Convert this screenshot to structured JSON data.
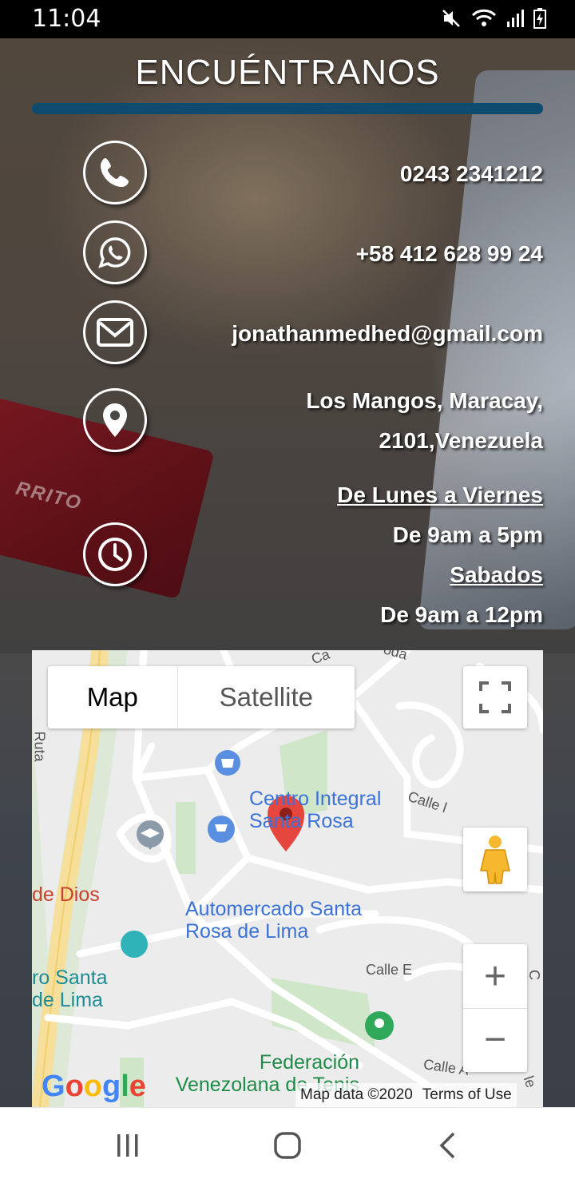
{
  "status_bar": {
    "time": "11:04",
    "icons": [
      "mute-icon",
      "wifi-icon",
      "signal-icon",
      "battery-charging-icon"
    ]
  },
  "header": {
    "title": "ENCUÉNTRANOS",
    "accent_color": "#0e4b6e"
  },
  "contact": {
    "phone": "0243 2341212",
    "whatsapp": "+58 412 628 99 24",
    "email": "jonathanmedhed@gmail.com",
    "address_line1": "Los Mangos, Maracay,",
    "address_line2": "2101,Venezuela",
    "hours": {
      "weekday_label": "De Lunes a Viernes",
      "weekday_hours": "De 9am a 5pm",
      "saturday_label": "Sabados",
      "saturday_hours": "De 9am a 12pm"
    }
  },
  "background_card_text": "RRITO",
  "map": {
    "type_map_label": "Map",
    "type_satellite_label": "Satellite",
    "pois": {
      "centro_line1": "Centro Integral",
      "centro_line2": "Santa Rosa",
      "automercado_line1": "Automercado Santa",
      "automercado_line2": "Rosa de Lima",
      "dios": "de Dios",
      "ro_santa_line1": "ro Santa",
      "ro_santa_line2": "de Lima",
      "federacion_line1": "Federación",
      "federacion_line2": "Venezolana de Tenis"
    },
    "streets": {
      "calle_l": "Calle l",
      "calle_e": "Calle E",
      "calle_a": "Calle A",
      "ruta": "Ruta",
      "ca_top": "Ca",
      "oda": "oda",
      "le": "le",
      "c_right": "C"
    },
    "zoom_in": "+",
    "zoom_out": "−",
    "logo": "Google",
    "map_data": "Map data ©2020",
    "terms": "Terms of Use"
  }
}
